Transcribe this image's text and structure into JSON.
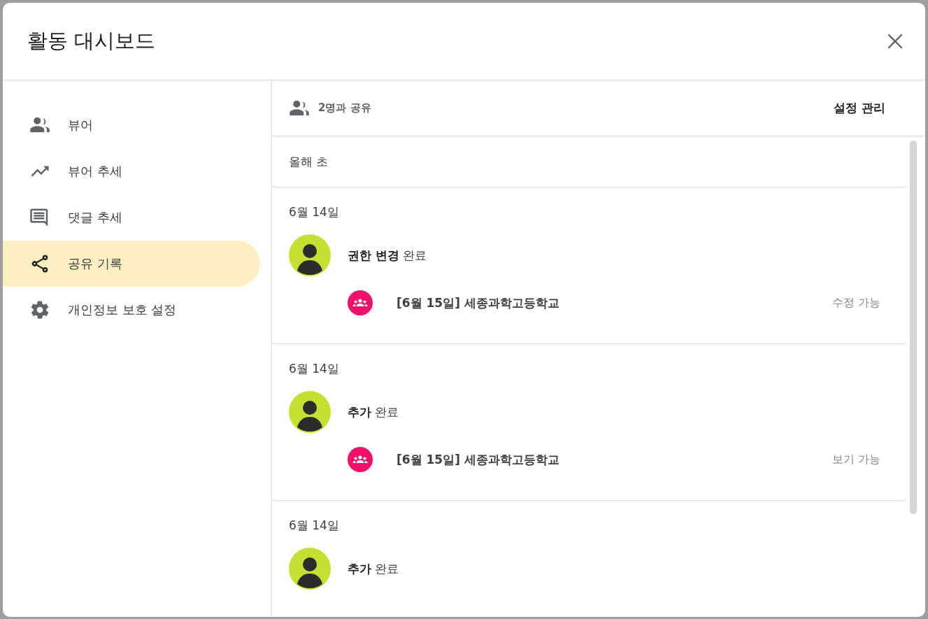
{
  "dialog": {
    "title": "활동 대시보드"
  },
  "sidebar": {
    "items": [
      {
        "label": "뷰어",
        "selected": false
      },
      {
        "label": "뷰어 추세",
        "selected": false
      },
      {
        "label": "댓글 추세",
        "selected": false
      },
      {
        "label": "공유 기록",
        "selected": true
      },
      {
        "label": "개인정보 보호 설정",
        "selected": false
      }
    ]
  },
  "share_header": {
    "summary": "2명과 공유",
    "manage_button": "설정 관리"
  },
  "section_heading": "올해 초",
  "entries": [
    {
      "date": "6월 14일",
      "action": "**권한 변경** 완료",
      "target": {
        "name": "[6월 15일] 세종과학고등학교",
        "permission": "수정 가능"
      }
    },
    {
      "date": "6월 14일",
      "action": "**추가** 완료",
      "target": {
        "name": "[6월 15일] 세종과학고등학교",
        "permission": "보기 가능"
      }
    },
    {
      "date": "6월 14일",
      "action": "**추가** 완료"
    }
  ]
}
